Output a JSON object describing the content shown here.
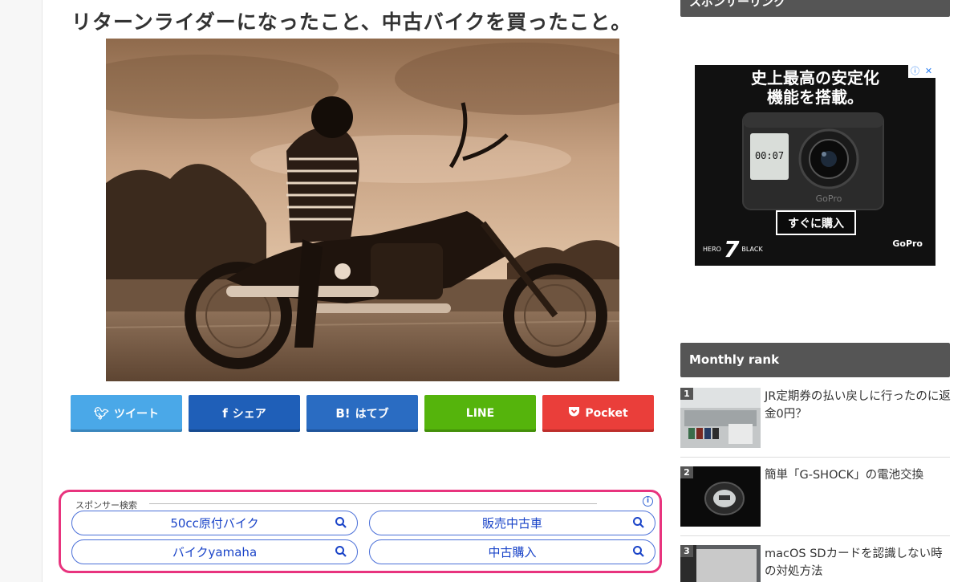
{
  "article": {
    "title": "リターンライダーになったこと、中古バイクを買ったこと。"
  },
  "share": {
    "buttons": [
      {
        "label": "ツイート",
        "icon": "twitter-bird-icon",
        "color": "#4aa8e8"
      },
      {
        "label": "シェア",
        "icon": "facebook-f-icon",
        "color": "#1f5fb8"
      },
      {
        "label": "はてブ",
        "icon": "hatena-b-icon",
        "color": "#2a6cc2"
      },
      {
        "label": "LINE",
        "icon": "",
        "color": "#55b40c"
      },
      {
        "label": "Pocket",
        "icon": "pocket-icon",
        "color": "#ea3e3a"
      }
    ]
  },
  "sponsor_search": {
    "label": "スポンサー検索",
    "accent": "#e8347e",
    "items": [
      "50cc原付バイク",
      "販売中古車",
      "バイクyamaha",
      "中古購入"
    ]
  },
  "sidebar": {
    "sponsor_heading": "スポンサーリンク",
    "ad": {
      "headline_line1": "史上最高の安定化",
      "headline_line2": "機能を搭載。",
      "screen_time": "00:07",
      "camera_brand": "GoPro",
      "cta": "すぐに購入",
      "hero_prefix": "HERO",
      "hero_number": "7",
      "hero_suffix": "BLACK",
      "logo": "GoPro"
    },
    "rank_heading": "Monthly rank",
    "rank_items": [
      {
        "rank": "1",
        "title": "JR定期券の払い戻しに行ったのに返金0円？"
      },
      {
        "rank": "2",
        "title": "簡単「G-SHOCK」の電池交換"
      },
      {
        "rank": "3",
        "title": "macOS SDカードを認識しない時の対処方法"
      }
    ]
  }
}
